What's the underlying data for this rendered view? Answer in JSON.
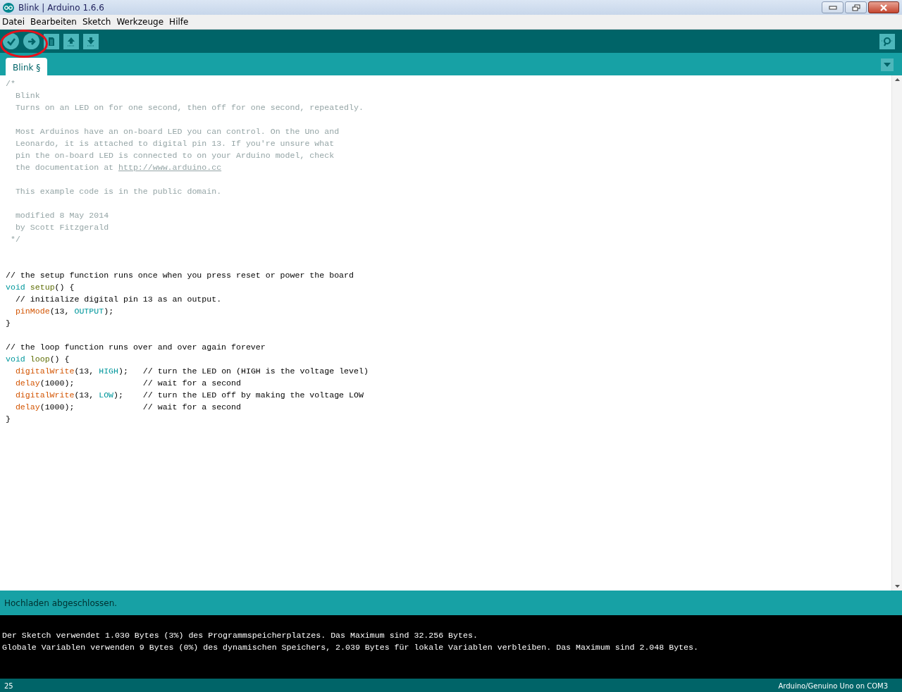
{
  "window": {
    "title": "Blink | Arduino 1.6.6"
  },
  "menu": [
    "Datei",
    "Bearbeiten",
    "Sketch",
    "Werkzeuge",
    "Hilfe"
  ],
  "toolbar": [
    {
      "kind": "verify"
    },
    {
      "kind": "upload"
    },
    {
      "kind": "new"
    },
    {
      "kind": "open"
    },
    {
      "kind": "save"
    }
  ],
  "highlight": {
    "color": "#e8101a"
  },
  "tabs": [
    {
      "label": "Blink §",
      "selected": true
    }
  ],
  "editor": {
    "lines": [
      {
        "kind": "code",
        "tokens": [
          {
            "kind": "comment",
            "text": "/*"
          }
        ]
      },
      {
        "kind": "code",
        "tokens": [
          {
            "kind": "comment",
            "text": "  Blink"
          }
        ]
      },
      {
        "kind": "code",
        "tokens": [
          {
            "kind": "comment",
            "text": "  Turns on an LED on for one second, then off for one second, repeatedly."
          }
        ]
      },
      {
        "kind": "blank"
      },
      {
        "kind": "code",
        "tokens": [
          {
            "kind": "comment",
            "text": "  Most Arduinos have an on-board LED you can control. On the Uno and"
          }
        ]
      },
      {
        "kind": "code",
        "tokens": [
          {
            "kind": "comment",
            "text": "  Leonardo, it is attached to digital pin 13. If you're unsure what"
          }
        ]
      },
      {
        "kind": "code",
        "tokens": [
          {
            "kind": "comment",
            "text": "  pin the on-board LED is connected to on your Arduino model, check"
          }
        ]
      },
      {
        "kind": "code",
        "tokens": [
          {
            "kind": "comment",
            "text": "  the documentation at "
          },
          {
            "kind": "link",
            "text": "http://www.arduino.cc"
          }
        ]
      },
      {
        "kind": "blank"
      },
      {
        "kind": "code",
        "tokens": [
          {
            "kind": "comment",
            "text": "  This example code is in the public domain."
          }
        ]
      },
      {
        "kind": "blank"
      },
      {
        "kind": "code",
        "tokens": [
          {
            "kind": "comment",
            "text": "  modified 8 May 2014"
          }
        ]
      },
      {
        "kind": "code",
        "tokens": [
          {
            "kind": "comment",
            "text": "  by Scott Fitzgerald"
          }
        ]
      },
      {
        "kind": "code",
        "tokens": [
          {
            "kind": "comment",
            "text": " */"
          }
        ]
      },
      {
        "kind": "blank"
      },
      {
        "kind": "blank"
      },
      {
        "kind": "code",
        "tokens": [
          {
            "kind": "plain",
            "text": "// the setup function runs once when you press reset or power the board"
          }
        ]
      },
      {
        "kind": "code",
        "tokens": [
          {
            "kind": "keyword",
            "text": "void "
          },
          {
            "kind": "function",
            "text": "setup"
          },
          {
            "kind": "plain",
            "text": "() {"
          }
        ]
      },
      {
        "kind": "code",
        "tokens": [
          {
            "kind": "plain",
            "text": "  // initialize digital pin 13 as an output."
          }
        ]
      },
      {
        "kind": "code",
        "tokens": [
          {
            "kind": "builtin",
            "text": "  pinMode"
          },
          {
            "kind": "plain",
            "text": "(13, "
          },
          {
            "kind": "constant",
            "text": "OUTPUT"
          },
          {
            "kind": "plain",
            "text": ");"
          }
        ]
      },
      {
        "kind": "code",
        "tokens": [
          {
            "kind": "plain",
            "text": "}"
          }
        ]
      },
      {
        "kind": "blank"
      },
      {
        "kind": "code",
        "tokens": [
          {
            "kind": "plain",
            "text": "// the loop function runs over and over again forever"
          }
        ]
      },
      {
        "kind": "code",
        "tokens": [
          {
            "kind": "keyword",
            "text": "void "
          },
          {
            "kind": "function",
            "text": "loop"
          },
          {
            "kind": "plain",
            "text": "() {"
          }
        ]
      },
      {
        "kind": "code",
        "tokens": [
          {
            "kind": "builtin",
            "text": "  digitalWrite"
          },
          {
            "kind": "plain",
            "text": "(13, "
          },
          {
            "kind": "constant",
            "text": "HIGH"
          },
          {
            "kind": "plain",
            "text": ");   // turn the LED on (HIGH is the voltage level)"
          }
        ]
      },
      {
        "kind": "code",
        "tokens": [
          {
            "kind": "builtin",
            "text": "  delay"
          },
          {
            "kind": "plain",
            "text": "(1000);              // wait for a second"
          }
        ]
      },
      {
        "kind": "code",
        "tokens": [
          {
            "kind": "builtin",
            "text": "  digitalWrite"
          },
          {
            "kind": "plain",
            "text": "(13, "
          },
          {
            "kind": "constant",
            "text": "LOW"
          },
          {
            "kind": "plain",
            "text": ");    // turn the LED off by making the voltage LOW"
          }
        ]
      },
      {
        "kind": "code",
        "tokens": [
          {
            "kind": "builtin",
            "text": "  delay"
          },
          {
            "kind": "plain",
            "text": "(1000);              // wait for a second"
          }
        ]
      },
      {
        "kind": "code",
        "tokens": [
          {
            "kind": "plain",
            "text": "}"
          }
        ]
      }
    ]
  },
  "status": "Hochladen abgeschlossen.",
  "console": [
    "Der Sketch verwendet 1.030 Bytes (3%) des Programmspeicherplatzes. Das Maximum sind 32.256 Bytes.",
    "Globale Variablen verwenden 9 Bytes (0%) des dynamischen Speichers, 2.039 Bytes für lokale Variablen verbleiben. Das Maximum sind 2.048 Bytes."
  ],
  "footer": {
    "line": "25",
    "board": "Arduino/Genuino Uno on COM3"
  }
}
